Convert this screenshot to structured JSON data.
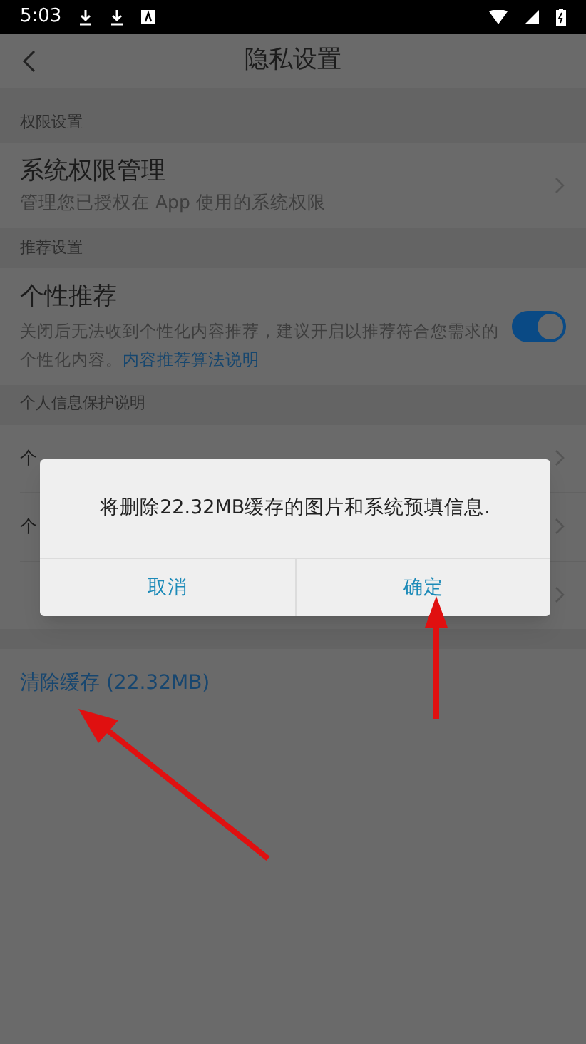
{
  "status_bar": {
    "time": "5:03"
  },
  "header": {
    "title": "隐私设置"
  },
  "sections": [
    {
      "title": "权限设置",
      "rows": [
        {
          "kind": "link",
          "title": "系统权限管理",
          "subtitle": "管理您已授权在 App 使用的系统权限"
        }
      ]
    },
    {
      "title": "推荐设置",
      "rows": [
        {
          "kind": "toggle",
          "title": "个性推荐",
          "subtitle": "关闭后无法收到个性化内容推荐，建议开启以推荐符合您需求的个性化内容。",
          "link": "内容推荐算法说明",
          "on": true
        }
      ]
    },
    {
      "title": "个人信息保护说明",
      "rows": [
        {
          "kind": "link",
          "title": "个"
        },
        {
          "kind": "link",
          "title": "个"
        },
        {
          "kind": "link"
        }
      ]
    }
  ],
  "clear_cache": "清除缓存 (22.32MB)",
  "dialog": {
    "message": "将删除22.32MB缓存的图片和系统预填信息.",
    "buttons": [
      "取消",
      "确定"
    ]
  }
}
